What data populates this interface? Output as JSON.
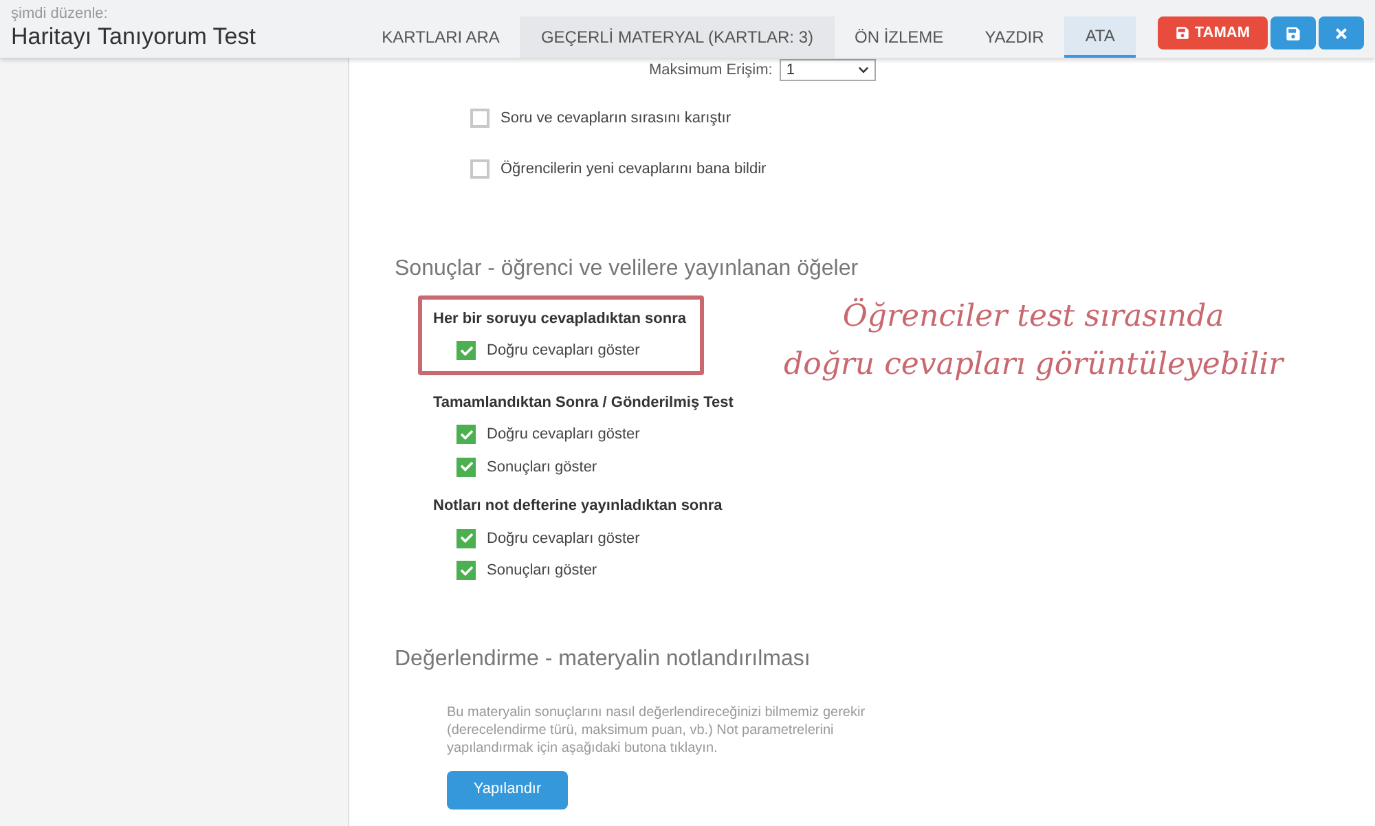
{
  "header": {
    "subtitle": "şimdi düzenle:",
    "title": "Haritayı Tanıyorum Test"
  },
  "tabs": [
    {
      "label": "KARTLARI ARA",
      "selected": false
    },
    {
      "label": "GEÇERLİ MATERYAL (KARTLAR: 3)",
      "selected": false
    },
    {
      "label": "ÖN İZLEME",
      "selected": false
    },
    {
      "label": "YAZDIR",
      "selected": false
    },
    {
      "label": "ATA",
      "selected": true
    }
  ],
  "actions": [
    {
      "kind": "done",
      "label": "TAMAM"
    },
    {
      "kind": "save"
    },
    {
      "kind": "close"
    }
  ],
  "max_access": {
    "label": "Maksimum Erişim:",
    "value": "1"
  },
  "options": [
    {
      "label": "Soru ve cevapların sırasını karıştır",
      "checked": false
    },
    {
      "label": "Öğrencilerin yeni cevaplarını bana bildir",
      "checked": false
    }
  ],
  "results": {
    "title": "Sonuçlar - öğrenci ve velilere yayınlanan öğeler",
    "groups": [
      {
        "title": "Her bir soruyu cevapladıktan sonra",
        "highlighted": true,
        "items": [
          {
            "label": "Doğru cevapları göster",
            "checked": true
          }
        ]
      },
      {
        "title": "Tamamlandıktan Sonra / Gönderilmiş Test",
        "highlighted": false,
        "items": [
          {
            "label": "Doğru cevapları göster",
            "checked": true
          },
          {
            "label": "Sonuçları göster",
            "checked": true
          }
        ]
      },
      {
        "title": "Notları not defterine yayınladıktan sonra",
        "highlighted": false,
        "items": [
          {
            "label": "Doğru cevapları göster",
            "checked": true
          },
          {
            "label": "Sonuçları göster",
            "checked": true
          }
        ]
      }
    ]
  },
  "annotation": [
    "Öğrenciler test sırasında",
    "doğru cevapları görüntüleyebilir"
  ],
  "grading": {
    "title": "Değerlendirme - materyalin notlandırılması",
    "text": "Bu materyalin sonuçlarını nasıl değerlendireceğinizi bilmemiz gerekir (derecelendirme türü, maksimum puan, vb.) Not parametrelerini yapılandırmak için aşağıdaki butona tıklayın.",
    "button": "Yapılandır"
  }
}
